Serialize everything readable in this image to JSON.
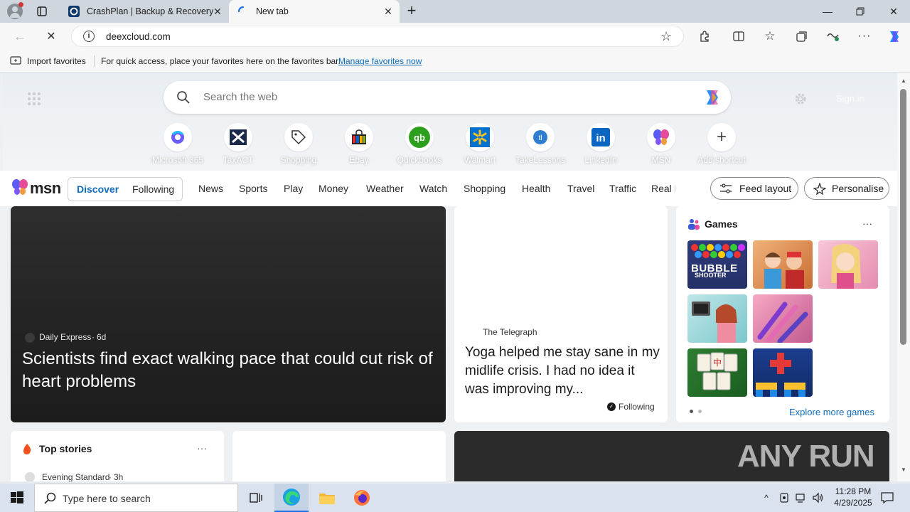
{
  "tabs": [
    {
      "title": "CrashPlan | Backup & Recovery S"
    },
    {
      "title": "New tab"
    }
  ],
  "address": {
    "url": "deexcloud.com"
  },
  "favbar": {
    "import_label": "Import favorites",
    "hint": "For quick access, place your favorites here on the favorites bar.",
    "manage_link": "Manage favorites now"
  },
  "search": {
    "placeholder": "Search the web",
    "signin": "Sign in"
  },
  "shortcuts": [
    {
      "label": "Microsoft 365"
    },
    {
      "label": "TaxACT"
    },
    {
      "label": "Shopping"
    },
    {
      "label": "Ebay"
    },
    {
      "label": "Quickbooks"
    },
    {
      "label": "Walmart"
    },
    {
      "label": "TakeLessons"
    },
    {
      "label": "LinkedIn"
    },
    {
      "label": "MSN"
    },
    {
      "label": "Add shortcut"
    }
  ],
  "msn": {
    "logo": "msn",
    "discover": "Discover",
    "following": "Following",
    "nav": [
      "News",
      "Sports",
      "Play",
      "Money",
      "Weather",
      "Watch",
      "Shopping",
      "Health",
      "Travel",
      "Traffic",
      "Real E"
    ],
    "feed_layout": "Feed layout",
    "personalise": "Personalise"
  },
  "main_story": {
    "source": "Daily Express",
    "age": "6d",
    "headline": "Scientists find exact walking pace that could cut risk of heart problems"
  },
  "telegraph": {
    "source": "The Telegraph",
    "headline": "Yoga helped me stay sane in my midlife crisis. I had no idea it was improving my...",
    "following": "Following"
  },
  "games": {
    "title": "Games",
    "more": "···",
    "explore": "Explore more games",
    "bubble_line1": "BUBBLE",
    "bubble_line2": "SHOOTER"
  },
  "top_stories": {
    "title": "Top stories",
    "source": "Evening Standard",
    "age": "3h"
  },
  "watermark": "ANY RUN",
  "taskbar": {
    "search_placeholder": "Type here to search",
    "time": "11:28 PM",
    "date": "4/29/2025"
  }
}
